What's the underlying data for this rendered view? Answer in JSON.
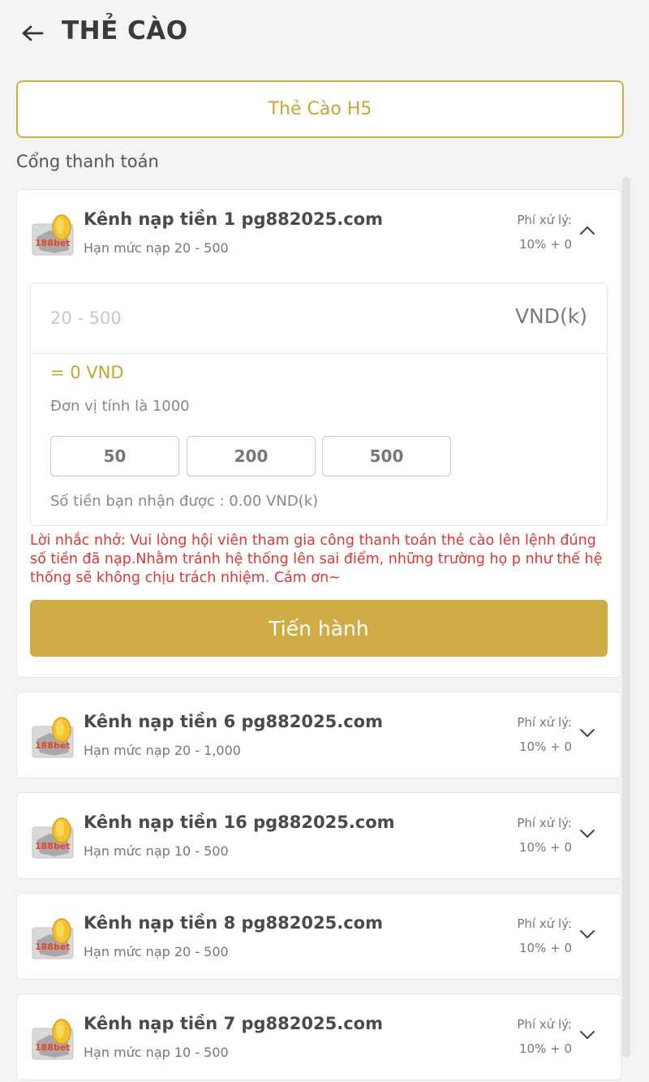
{
  "header": {
    "title": "THẺ CÀO"
  },
  "method_tab": {
    "label": "Thẻ Cào H5"
  },
  "section_label": "Cổng thanh toán",
  "channels": [
    {
      "title": "Kênh nạp tiền 1 pg882025.com",
      "limit": "Hạn mức nạp 20 - 500",
      "fee_label": "Phí xử lý:",
      "fee_value": "10% + 0",
      "expanded": true
    },
    {
      "title": "Kênh nạp tiền 6 pg882025.com",
      "limit": "Hạn mức nạp 20 - 1,000",
      "fee_label": "Phí xử lý:",
      "fee_value": "10% + 0",
      "expanded": false
    },
    {
      "title": "Kênh nạp tiền 16 pg882025.com",
      "limit": "Hạn mức nạp 10 - 500",
      "fee_label": "Phí xử lý:",
      "fee_value": "10% + 0",
      "expanded": false
    },
    {
      "title": "Kênh nạp tiền 8 pg882025.com",
      "limit": "Hạn mức nạp 20 - 500",
      "fee_label": "Phí xử lý:",
      "fee_value": "10% + 0",
      "expanded": false
    },
    {
      "title": "Kênh nạp tiền 7 pg882025.com",
      "limit": "Hạn mức nạp 10 - 500",
      "fee_label": "Phí xử lý:",
      "fee_value": "10% + 0",
      "expanded": false
    }
  ],
  "form": {
    "amount_placeholder": "20 - 500",
    "amount_value": "",
    "unit": "VND(k)",
    "converted": "= 0 VND",
    "unit_note": "Đơn vị tính là 1000",
    "quick_amounts": [
      "50",
      "200",
      "500"
    ],
    "receive_text": "Số tiền bạn nhận được : 0.00 VND(k)"
  },
  "reminder": "Lời nhắc nhở: Vui lòng hội viên tham gia công thanh toán thẻ cào lên lệnh đúng số tiền đã nạp.Nhằm tránh hệ thống lên sai điểm, những trường họ p như thế hệ thống sẽ không chịu trách nhiệm. Cảm ơn~",
  "proceed_button": "Tiến hành",
  "colors": {
    "accent": "#d0ac47",
    "accent_text": "#c9a436",
    "warning": "#e23636",
    "background": "#f4f4f4"
  },
  "icons": {
    "back": "arrow-left-icon",
    "channel_logo": "channel-logo-icon",
    "expanded": "chevron-up-icon",
    "collapsed": "chevron-down-icon"
  }
}
